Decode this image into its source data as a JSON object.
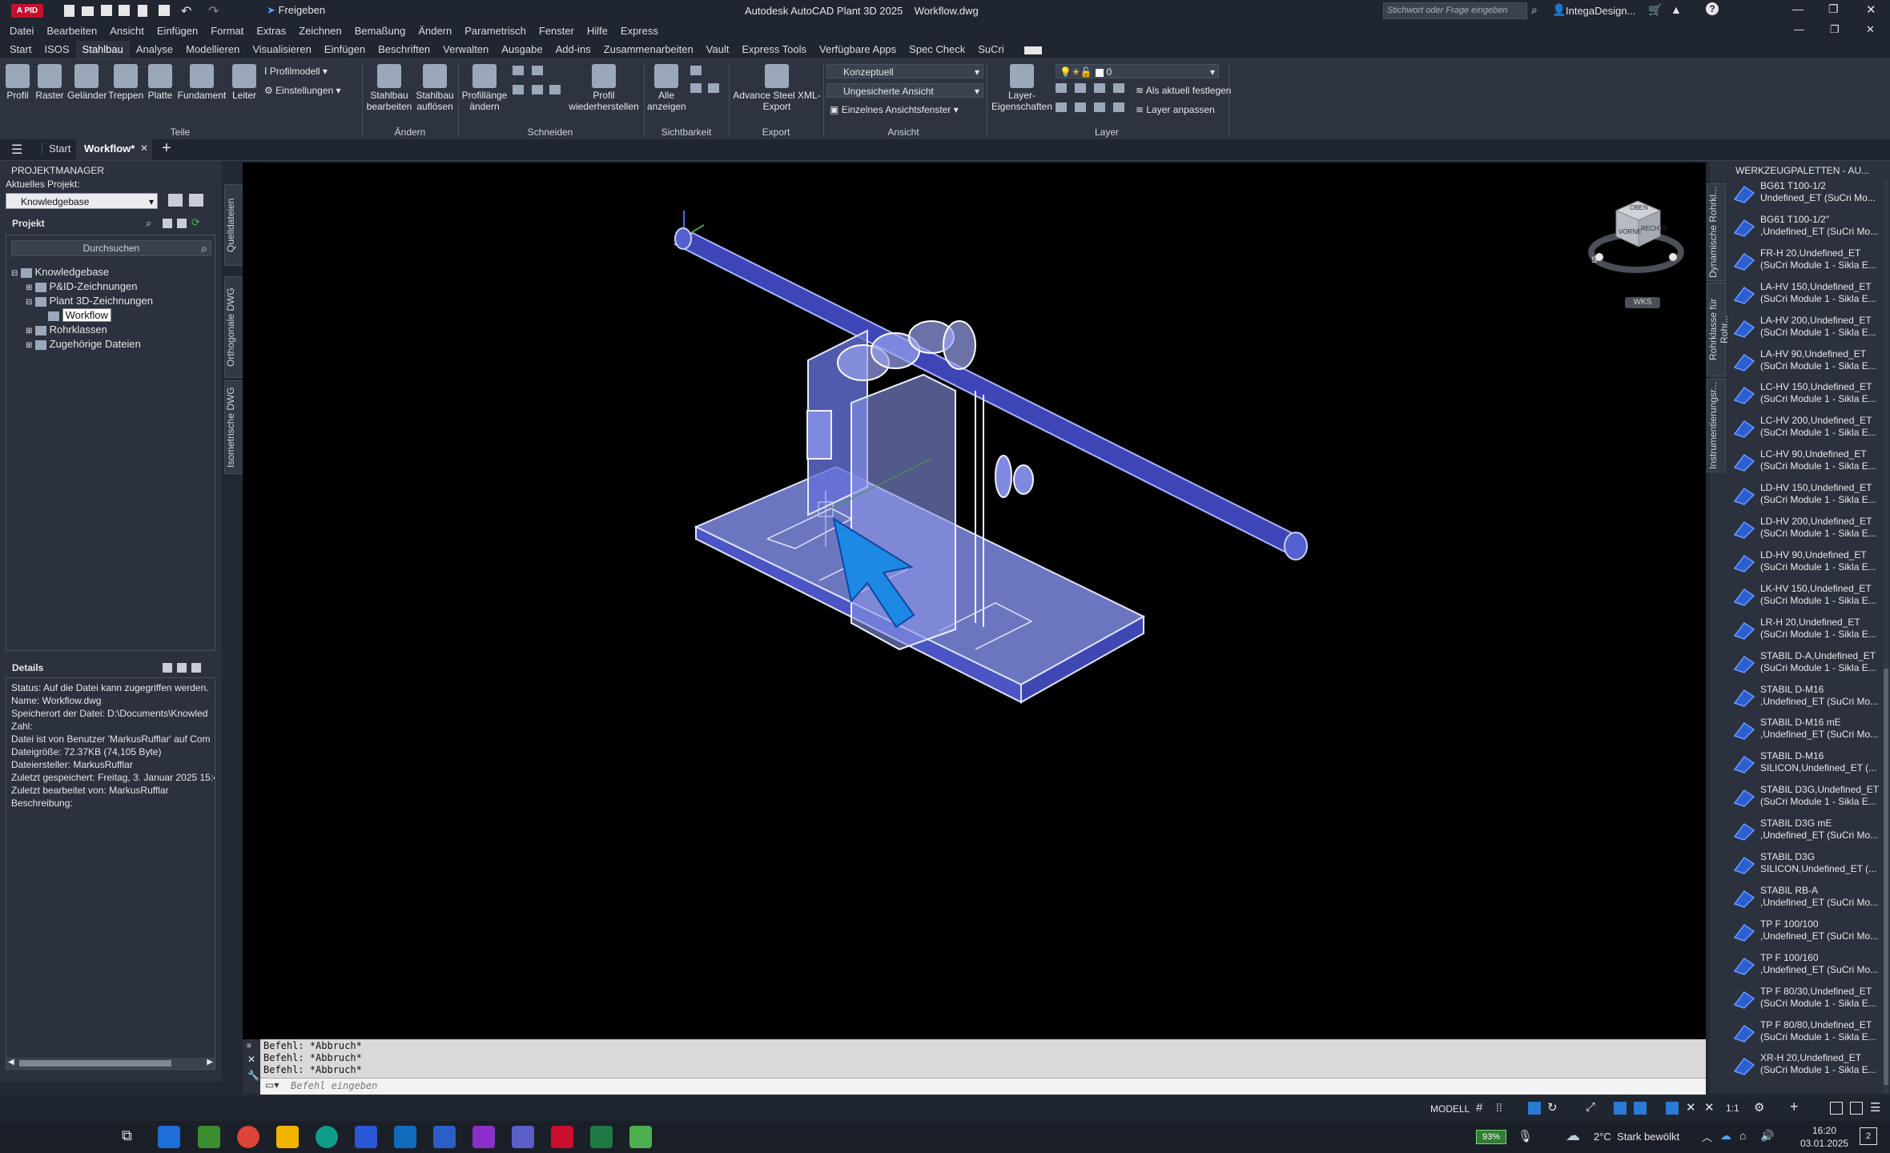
{
  "window": {
    "title": "Autodesk AutoCAD Plant 3D 2025    Workflow.dwg",
    "app_badge": "A PID",
    "share_label": "Freigeben",
    "search_placeholder": "Stichwort oder Frage eingeben",
    "user": "IntegaDesign...",
    "help": "?"
  },
  "menu": [
    "Datei",
    "Bearbeiten",
    "Ansicht",
    "Einfügen",
    "Format",
    "Extras",
    "Zeichnen",
    "Bemaßung",
    "Ändern",
    "Parametrisch",
    "Fenster",
    "Hilfe",
    "Express"
  ],
  "ribbon_tabs": [
    "Start",
    "ISOS",
    "Stahlbau",
    "Analyse",
    "Modellieren",
    "Visualisieren",
    "Einfügen",
    "Beschriften",
    "Verwalten",
    "Ausgabe",
    "Add-ins",
    "Zusammenarbeiten",
    "Vault",
    "Express Tools",
    "Verfügbare Apps",
    "Spec Check",
    "SuCri"
  ],
  "ribbon": {
    "teile": [
      "Profil",
      "Raster",
      "Geländer",
      "Treppen",
      "Platte",
      "Fundament",
      "Leiter"
    ],
    "profilmodell": "Profilmodell",
    "einstellungen": "Einstellungen",
    "teile_label": "Teile",
    "stahlbau_bearbeiten": "Stahlbau bearbeiten",
    "stahlbau_aufloesen": "Stahlbau auflösen",
    "aendern_label": "Ändern",
    "profillaenge": "Profillänge ändern",
    "profil_wieder": "Profil wiederherstellen",
    "schneiden_label": "Schneiden",
    "alle_anzeigen": "Alle anzeigen",
    "sichtbarkeit_label": "Sichtbarkeit",
    "advance_steel": "Advance Steel XML-Export",
    "export_label": "Export",
    "visual_style": "Konzeptuell",
    "view": "Ungesicherte Ansicht",
    "single_view": "Einzelnes Ansichtsfenster",
    "ansicht_label": "Ansicht",
    "layer_props": "Layer-Eigenschaften",
    "layer_current": "0",
    "als_aktuell": "Als aktuell festlegen",
    "layer_anpassen": "Layer anpassen",
    "layer_label": "Layer"
  },
  "doc_tabs": [
    "Start",
    "Workflow*"
  ],
  "project_manager": {
    "title": "PROJEKTMANAGER",
    "current_project_label": "Aktuelles Projekt:",
    "current_project": "Knowledgebase",
    "projekt_label": "Projekt",
    "search": "Durchsuchen",
    "tree": [
      "Knowledgebase",
      "P&ID-Zeichnungen",
      "Plant 3D-Zeichnungen",
      "Workflow",
      "Rohrklassen",
      "Zugehörige Dateien"
    ],
    "details_label": "Details",
    "details": [
      "Status: Auf die Datei kann zugegriffen werden.",
      "Name: Workflow.dwg",
      "Speicherort der Datei: D:\\Documents\\Knowled",
      "Zahl:",
      "Datei ist von Benutzer 'MarkusRufflar' auf Com",
      "Dateigröße: 72.37KB (74,105 Byte)",
      "Dateiersteller: MarkusRufflar",
      "Zuletzt gespeichert: Freitag, 3. Januar 2025 15:4",
      "Zuletzt bearbeitet von: MarkusRufflar",
      "Beschreibung:"
    ]
  },
  "side_tabs": [
    "Quelldateien",
    "Orthogonale DWG",
    "Isometrische DWG"
  ],
  "viewcube": {
    "top": "OBEN",
    "front": "VORNE",
    "right": "RECHTS",
    "south": "S",
    "wcs": "WKS"
  },
  "command": {
    "lines": [
      "Befehl: *Abbruch*",
      "Befehl: *Abbruch*",
      "Befehl: *Abbruch*"
    ],
    "placeholder": "Befehl eingeben"
  },
  "tool_palette": {
    "title": "WERKZEUGPALETTEN - AU...",
    "side_tabs": [
      "Dynamische Rohrkl...",
      "Rohrklasse für Rohr...",
      "Instrumentierungsr..."
    ],
    "items": [
      [
        "BG61 T100-1/2",
        "Undefined_ET (SuCri Mo..."
      ],
      [
        "BG61 T100-1/2\"",
        ",Undefined_ET (SuCri Mo..."
      ],
      [
        "FR-H 20,Undefined_ET",
        "(SuCri Module 1 - Sikla E..."
      ],
      [
        "LA-HV 150,Undefined_ET",
        "(SuCri Module 1 - Sikla E..."
      ],
      [
        "LA-HV 200,Undefined_ET",
        "(SuCri Module 1 - Sikla E..."
      ],
      [
        "LA-HV 90,Undefined_ET",
        "(SuCri Module 1 - Sikla E..."
      ],
      [
        "LC-HV 150,Undefined_ET",
        "(SuCri Module 1 - Sikla E..."
      ],
      [
        "LC-HV 200,Undefined_ET",
        "(SuCri Module 1 - Sikla E..."
      ],
      [
        "LC-HV 90,Undefined_ET",
        "(SuCri Module 1 - Sikla E..."
      ],
      [
        "LD-HV 150,Undefined_ET",
        "(SuCri Module 1 - Sikla E..."
      ],
      [
        "LD-HV 200,Undefined_ET",
        "(SuCri Module 1 - Sikla E..."
      ],
      [
        "LD-HV 90,Undefined_ET",
        "(SuCri Module 1 - Sikla E..."
      ],
      [
        "LK-HV 150,Undefined_ET",
        "(SuCri Module 1 - Sikla E..."
      ],
      [
        "LR-H 20,Undefined_ET",
        "(SuCri Module 1 - Sikla E..."
      ],
      [
        "STABIL D-A,Undefined_ET",
        "(SuCri Module 1 - Sikla E..."
      ],
      [
        "STABIL D-M16",
        ",Undefined_ET (SuCri Mo..."
      ],
      [
        "STABIL D-M16 mE",
        ",Undefined_ET (SuCri Mo..."
      ],
      [
        "STABIL D-M16",
        "SILICON,Undefined_ET (..."
      ],
      [
        "STABIL D3G,Undefined_ET",
        "(SuCri Module 1 - Sikla E..."
      ],
      [
        "STABIL D3G mE",
        ",Undefined_ET (SuCri Mo..."
      ],
      [
        "STABIL D3G",
        "SILICON,Undefined_ET (..."
      ],
      [
        "STABIL RB-A",
        ",Undefined_ET (SuCri Mo..."
      ],
      [
        "TP F 100/100",
        ",Undefined_ET (SuCri Mo..."
      ],
      [
        "TP F 100/160",
        ",Undefined_ET (SuCri Mo..."
      ],
      [
        "TP F 80/30,Undefined_ET",
        "(SuCri Module 1 - Sikla E..."
      ],
      [
        "TP F 80/80,Undefined_ET",
        "(SuCri Module 1 - Sikla E..."
      ],
      [
        "XR-H 20,Undefined_ET",
        "(SuCri Module 1 - Sikla E..."
      ]
    ]
  },
  "status": {
    "model": "MODELL",
    "scale": "1:1"
  },
  "taskbar": {
    "battery": "93%",
    "weather": "2°C  Stark bewölkt",
    "time": "16:20",
    "date": "03.01.2025",
    "notif": "2"
  },
  "colors": {
    "accent": "#2a7bd6",
    "pipe": "#4a57c8",
    "model": "#8f9ae8",
    "cursor": "#1e88e5"
  }
}
